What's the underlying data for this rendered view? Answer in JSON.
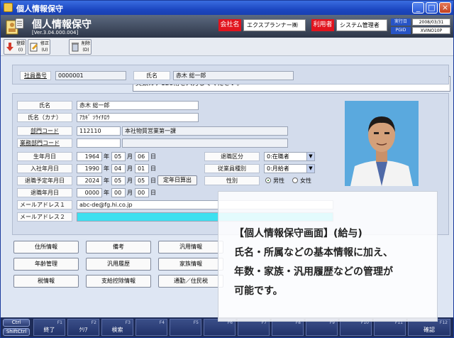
{
  "window": {
    "title": "個人情報保守"
  },
  "header": {
    "app_title": "個人情報保守",
    "version": "[Ver.3.04.000.004]",
    "company_label": "会社名",
    "company_value": "エクスプランナー㈱",
    "user_label": "利用者",
    "user_value": "システム管理者",
    "date_label": "実行日",
    "date_value": "2008/03/31",
    "pgid_label": "PGID",
    "pgid_value": "XVINO10P"
  },
  "toolbar": {
    "register": "登録\n(I)",
    "modify": "修正\n(U)",
    "delete": "削除\n(D)",
    "message": "英数カナ128桁を入力してください。"
  },
  "top": {
    "emp_no_label": "社員番号",
    "emp_no_value": "0000001",
    "name_label": "氏名",
    "name_value": "赤木 総一郎"
  },
  "form": {
    "name_label": "氏名",
    "name_value": "赤木 総一郎",
    "kana_label": "氏名（カナ）",
    "kana_value": "ｱｶｷﾞ ｿｳｲﾁﾛｳ",
    "dept_label": "部門コード",
    "dept_code": "112110",
    "dept_name": "本社物質営業第一課",
    "biz_label": "業務部門コード",
    "birth_label": "生年月日",
    "birth_y": "1964",
    "birth_m": "05",
    "birth_d": "06",
    "join_label": "入社年月日",
    "join_y": "1990",
    "join_m": "04",
    "join_d": "01",
    "retire_plan_label": "退職予定年月日",
    "retire_plan_y": "2024",
    "retire_plan_m": "05",
    "retire_plan_d": "05",
    "retire_label": "退職年月日",
    "retire_y": "0000",
    "retire_m": "00",
    "retire_d": "00",
    "unit_y": "年",
    "unit_m": "月",
    "unit_d": "日",
    "calc_btn": "定年日算出",
    "retire_div_label": "退職区分",
    "retire_div_value": "0:在職者",
    "emp_type_label": "従業員種別",
    "emp_type_value": "0:月給者",
    "gender_label": "性別",
    "gender_male": "男性",
    "gender_female": "女性",
    "mail1_label": "メールアドレス１",
    "mail1_value": "abc-de@fg.hi.co.jp",
    "mail2_label": "メールアドレス２"
  },
  "nav": [
    "住所情報",
    "備考",
    "汎用情報",
    "年齢管理",
    "汎用履歴",
    "家族情報",
    "税情報",
    "支給控除情報",
    "通勤／住民税"
  ],
  "fkeys": [
    {
      "n": "F1",
      "l": "終了"
    },
    {
      "n": "F2",
      "l": "ｸﾘｱ"
    },
    {
      "n": "F3",
      "l": "検索"
    },
    {
      "n": "F4",
      "l": ""
    },
    {
      "n": "F5",
      "l": ""
    },
    {
      "n": "F6",
      "l": ""
    },
    {
      "n": "F7",
      "l": ""
    },
    {
      "n": "F8",
      "l": ""
    },
    {
      "n": "F9",
      "l": ""
    },
    {
      "n": "F10",
      "l": ""
    },
    {
      "n": "F11",
      "l": ""
    },
    {
      "n": "F12",
      "l": "確認"
    }
  ],
  "mods": {
    "ctrl": "Ctrl",
    "shift": "ShiftCtrl"
  },
  "overlay": {
    "line1": "【個人情報保守画面】(給与)",
    "line2": "氏名・所属などの基本情報に加え、",
    "line3": "年数・家族・汎用履歴などの管理が",
    "line4": "可能です。"
  },
  "colors": {
    "accent_red": "#e1141e",
    "title_blue": "#1d48c2"
  }
}
